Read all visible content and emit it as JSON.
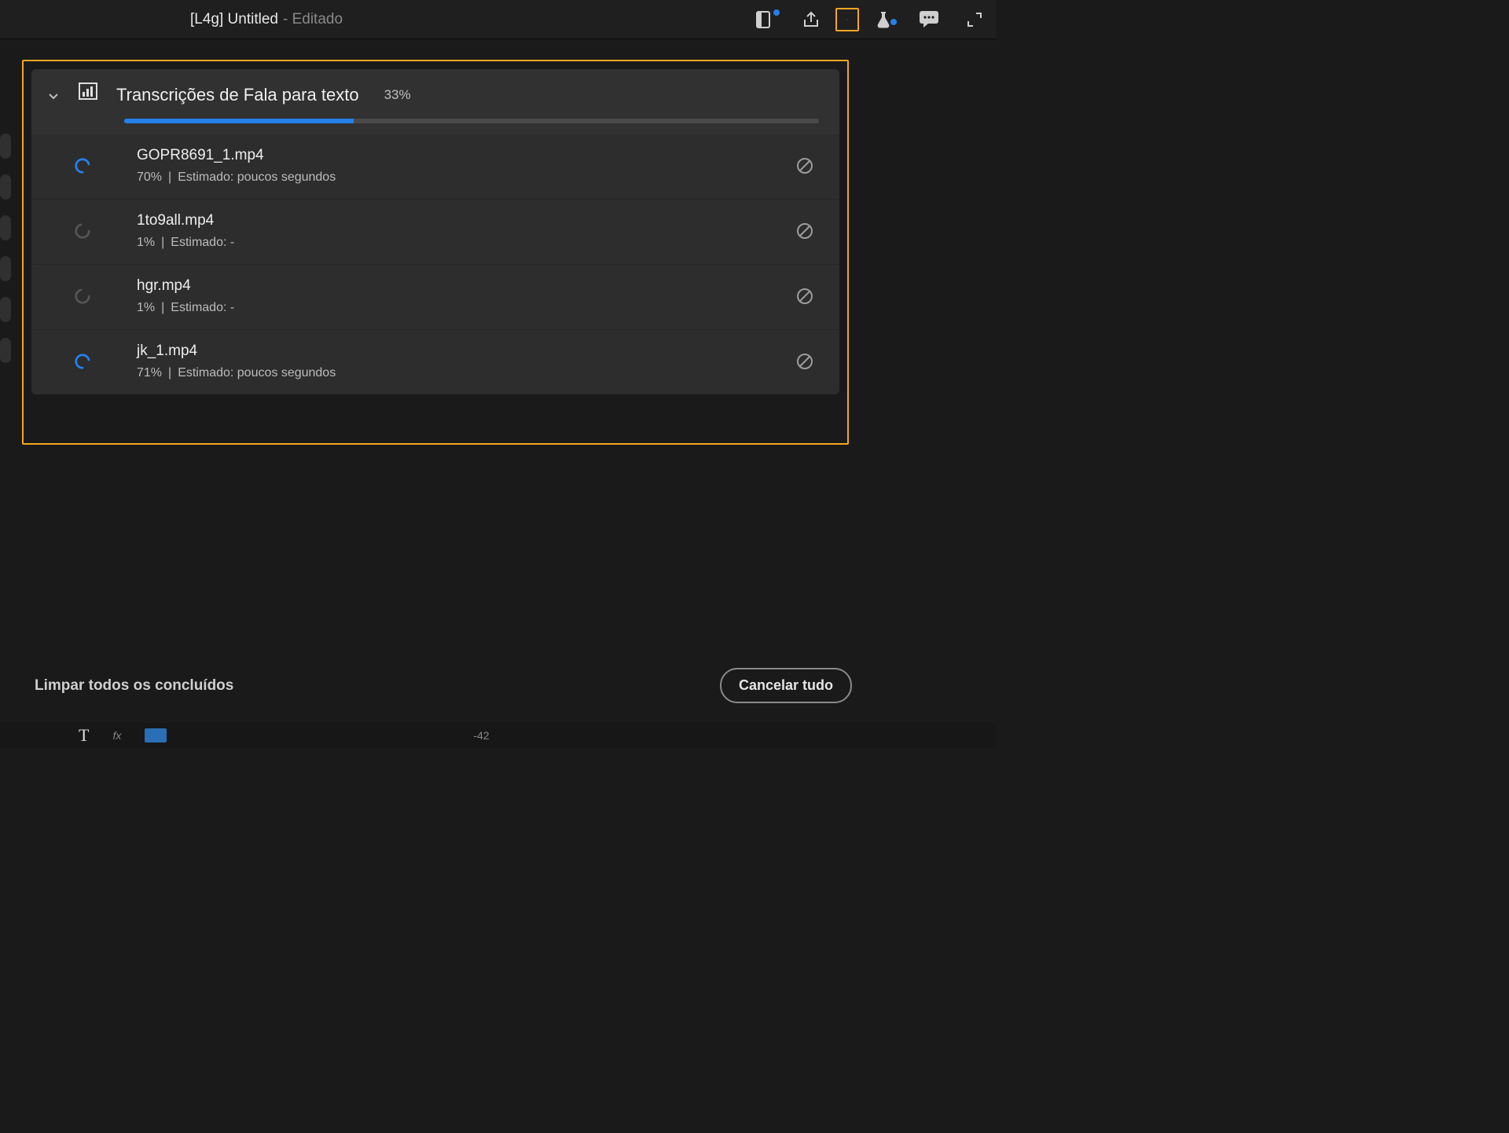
{
  "header": {
    "title_prefix": "[L4g] Untitled",
    "title_suffix": "- Editado"
  },
  "progress_group": {
    "title": "Transcrições de Fala para texto",
    "percent_label": "33%",
    "percent_value": 33,
    "items": [
      {
        "name": "GOPR8691_1.mp4",
        "percent": "70%",
        "sep": "|",
        "eta_label": "Estimado: poucos segundos",
        "active": true
      },
      {
        "name": "1to9all.mp4",
        "percent": "1%",
        "sep": "|",
        "eta_label": "Estimado: -",
        "active": false
      },
      {
        "name": "hgr.mp4",
        "percent": "1%",
        "sep": "|",
        "eta_label": "Estimado: -",
        "active": false
      },
      {
        "name": "jk_1.mp4",
        "percent": "71%",
        "sep": "|",
        "eta_label": "Estimado: poucos segundos",
        "active": true
      }
    ]
  },
  "footer": {
    "clear_completed": "Limpar todos os concluídos",
    "cancel_all": "Cancelar tudo"
  },
  "timeline": {
    "marker": "-42"
  }
}
